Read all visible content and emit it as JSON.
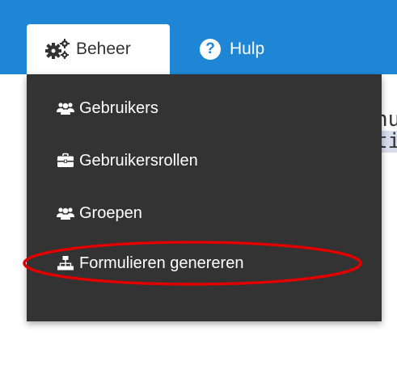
{
  "header": {
    "tabs": [
      {
        "label": "Beheer",
        "icon": "gears-icon",
        "active": true
      },
      {
        "label": "Hulp",
        "icon": "question-circle-icon",
        "active": false
      }
    ],
    "bar_color": "#1f86d5"
  },
  "dropdown": {
    "items": [
      {
        "label": "Gebruikers",
        "icon": "users-icon"
      },
      {
        "label": "Gebruikersrollen",
        "icon": "briefcase-icon"
      },
      {
        "label": "Groepen",
        "icon": "users-icon"
      },
      {
        "label": "Formulieren genereren",
        "icon": "sitemap-icon",
        "highlighted": true
      }
    ],
    "background": "#333333"
  },
  "background_text": [
    "nu",
    "ti"
  ],
  "annotation": {
    "color": "#e00000"
  }
}
